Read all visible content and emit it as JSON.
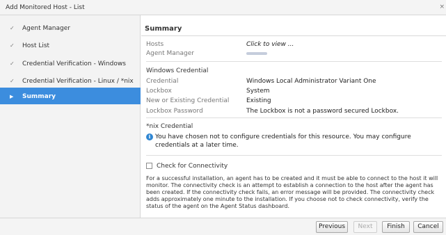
{
  "window": {
    "title": "Add Monitored Host - List",
    "close_glyph": "×"
  },
  "sidebar": {
    "items": [
      {
        "label": "Agent Manager",
        "state": "complete"
      },
      {
        "label": "Host List",
        "state": "complete"
      },
      {
        "label": "Credential Verification - Windows",
        "state": "complete"
      },
      {
        "label": "Credential Verification - Linux / *nix",
        "state": "complete"
      },
      {
        "label": "Summary",
        "state": "active"
      }
    ],
    "active_color": "#3c8dde"
  },
  "summary": {
    "title": "Summary",
    "hosts_label": "Hosts",
    "hosts_value": "Click to view ...",
    "agent_manager_label": "Agent Manager",
    "windows": {
      "title": "Windows Credential",
      "credential_label": "Credential",
      "credential_value": "Windows Local Administrator Variant One",
      "lockbox_label": "Lockbox",
      "lockbox_value": "System",
      "new_existing_label": "New or Existing Credential",
      "new_existing_value": "Existing",
      "lockbox_password_label": "Lockbox Password",
      "lockbox_password_value": "The Lockbox is not a password secured Lockbox."
    },
    "nix": {
      "title": "*nix Credential",
      "info_text": "You have chosen not to configure credentials for this resource. You may configure credentials at a later time."
    },
    "connectivity": {
      "label": "Check for Connectivity",
      "checked": false,
      "description": "For a successful installation, an agent has to be created and it must be able to connect to the host it will monitor. The connectivity check is an attempt to establish a connection to the host after the agent has been created. If the connectivity check fails, an error message will be provided. The connectivity check adds approximately one minute to the installation. If you choose not to check connectivity, verify the status of the agent on the Agent Status dashboard."
    }
  },
  "footer": {
    "previous_label": "Previous",
    "next_label": "Next",
    "finish_label": "Finish",
    "cancel_label": "Cancel"
  },
  "icons": {
    "check": "✓",
    "active_arrow": "▶",
    "info": "i"
  }
}
